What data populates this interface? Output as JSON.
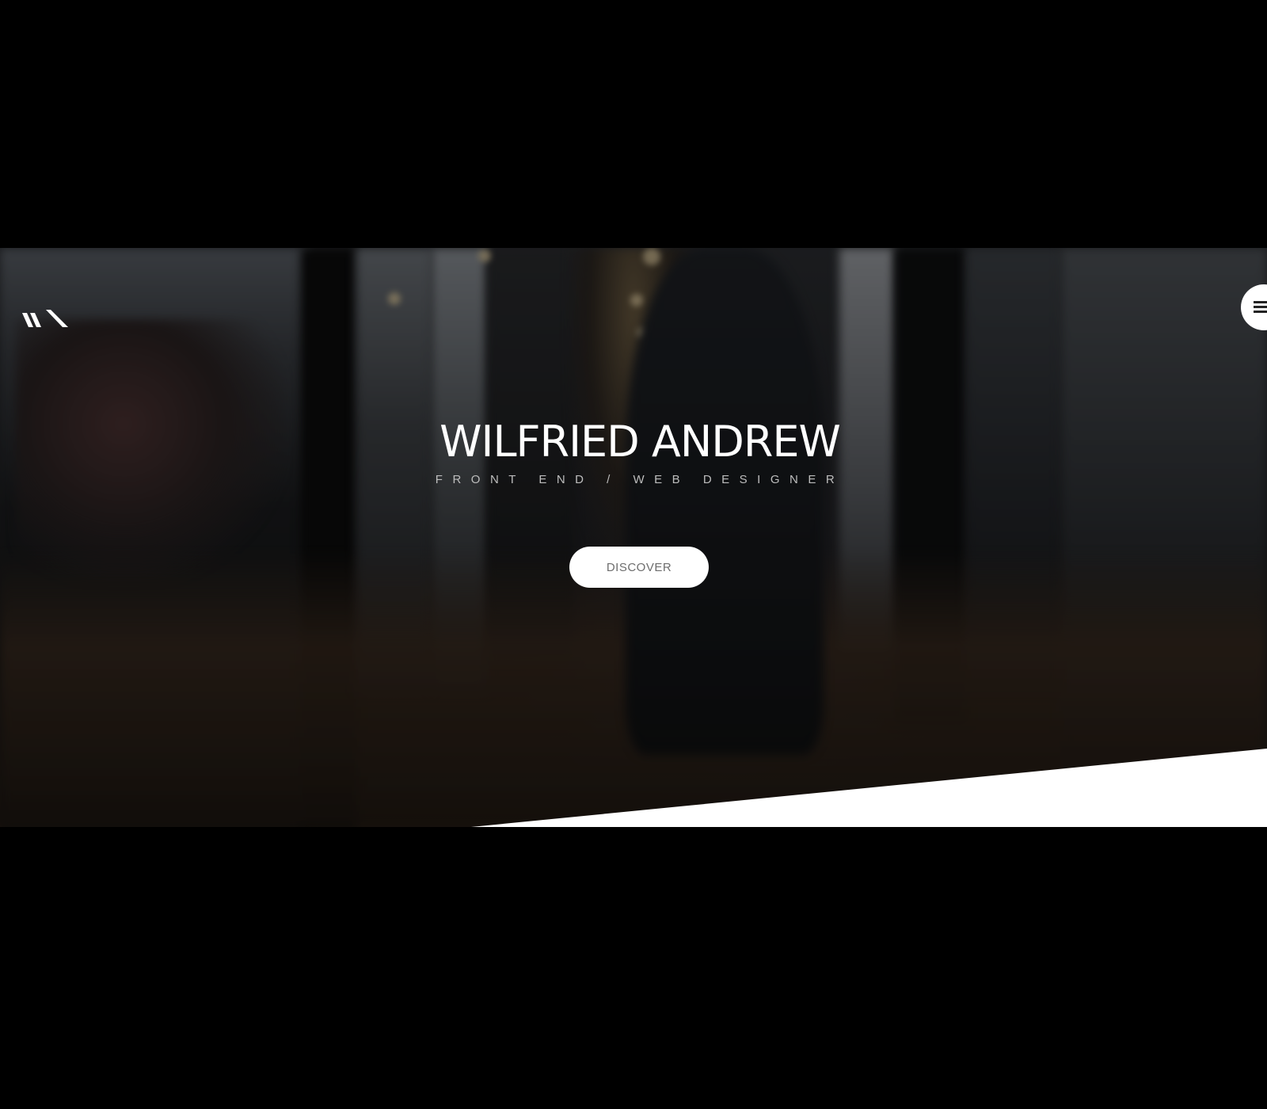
{
  "hero": {
    "title": "WILFRIED ANDREW",
    "subtitle": "FRONT END / WEB DESIGNER",
    "cta_label": "DISCOVER"
  },
  "header": {
    "logo_icon": "wa-monogram-icon",
    "menu_icon": "hamburger-menu-icon"
  },
  "colors": {
    "page_background": "#000000",
    "text_primary": "#ffffff",
    "button_background": "#ffffff",
    "button_text": "#6d6d6d"
  }
}
